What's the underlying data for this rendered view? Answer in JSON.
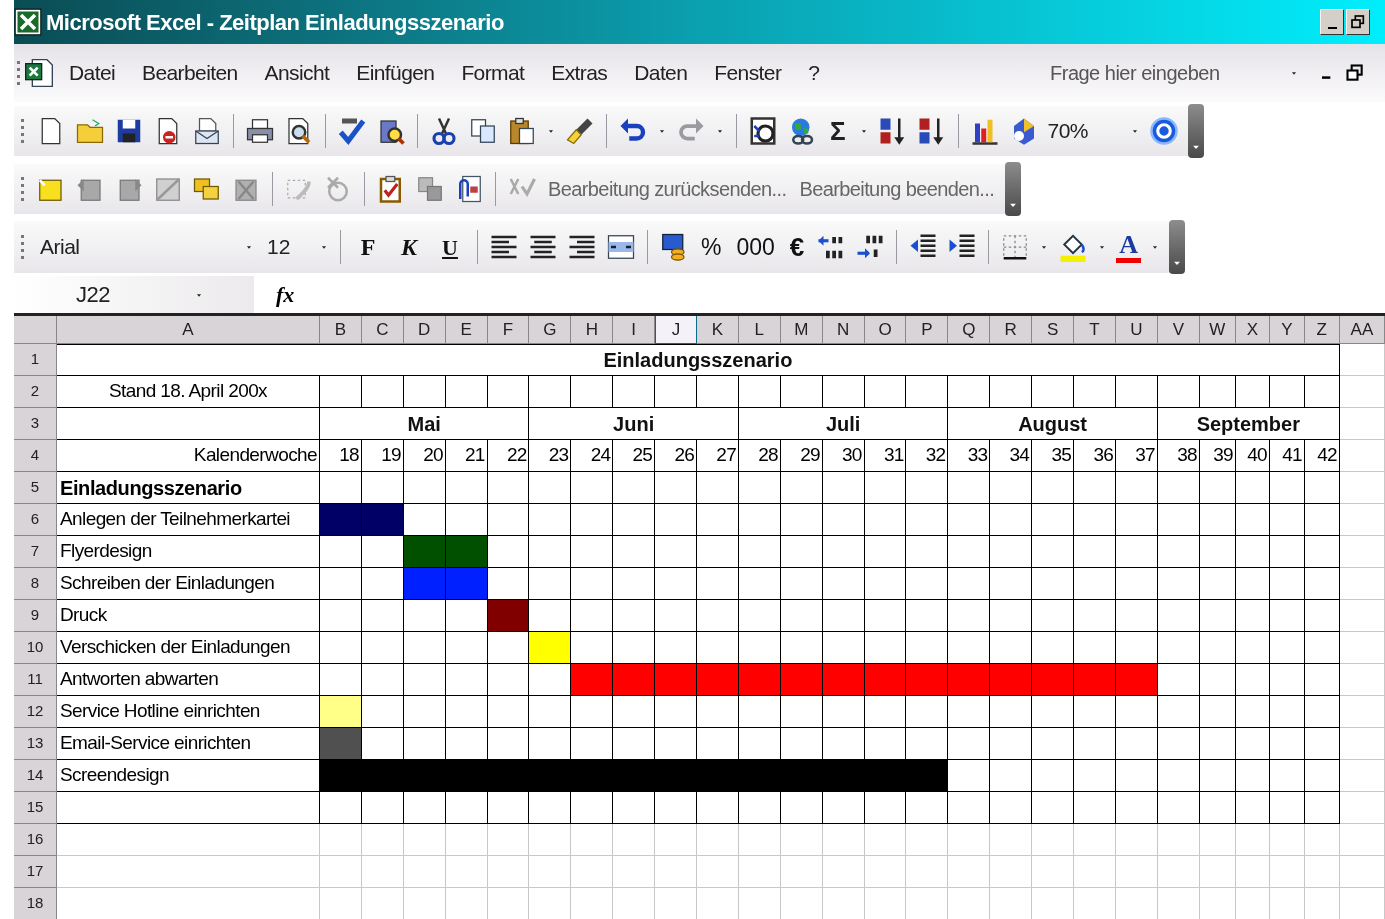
{
  "window": {
    "title": "Microsoft Excel - Zeitplan Einladungsszenario"
  },
  "menu": {
    "items": [
      "Datei",
      "Bearbeiten",
      "Ansicht",
      "Einfügen",
      "Format",
      "Extras",
      "Daten",
      "Fenster",
      "?"
    ],
    "question_placeholder": "Frage hier eingeben"
  },
  "standard_toolbar": {
    "sum": "Σ",
    "zoom": "70%"
  },
  "review_toolbar": {
    "buttons": [
      "Bearbeitung zurücksenden...",
      "Bearbeitung beenden..."
    ]
  },
  "format_toolbar": {
    "font": "Arial",
    "size": "12",
    "style_buttons": [
      "F",
      "K",
      "U"
    ],
    "number_buttons": [
      "%",
      "000",
      "€"
    ],
    "font_color": "A"
  },
  "formula_bar": {
    "name_box": "J22",
    "function_label": "fx"
  },
  "sheet": {
    "columns": [
      {
        "label": "A",
        "selected": false
      },
      {
        "label": "B",
        "selected": false
      },
      {
        "label": "C",
        "selected": false
      },
      {
        "label": "D",
        "selected": false
      },
      {
        "label": "E",
        "selected": false
      },
      {
        "label": "F",
        "selected": false
      },
      {
        "label": "G",
        "selected": false
      },
      {
        "label": "H",
        "selected": false
      },
      {
        "label": "I",
        "selected": false
      },
      {
        "label": "J",
        "selected": true
      },
      {
        "label": "K",
        "selected": false
      },
      {
        "label": "L",
        "selected": false
      },
      {
        "label": "M",
        "selected": false
      },
      {
        "label": "N",
        "selected": false
      },
      {
        "label": "O",
        "selected": false
      },
      {
        "label": "P",
        "selected": false
      },
      {
        "label": "Q",
        "selected": false
      },
      {
        "label": "R",
        "selected": false
      },
      {
        "label": "S",
        "selected": false
      },
      {
        "label": "T",
        "selected": false
      },
      {
        "label": "U",
        "selected": false
      },
      {
        "label": "V",
        "selected": false
      },
      {
        "label": "W",
        "selected": false
      },
      {
        "label": "X",
        "selected": false
      },
      {
        "label": "Y",
        "selected": false
      },
      {
        "label": "Z",
        "selected": false
      },
      {
        "label": "AA",
        "selected": false
      }
    ],
    "row_numbers": [
      "1",
      "2",
      "3",
      "4",
      "5",
      "6",
      "7",
      "8",
      "9",
      "10",
      "11",
      "12",
      "13",
      "14",
      "15",
      "16",
      "17",
      "18"
    ],
    "title": "Einladungsszenario",
    "stand": "Stand 18. April 200x",
    "months": [
      "Mai",
      "Juni",
      "Juli",
      "August",
      "September"
    ],
    "week_label": "Kalenderwoche",
    "weeks": [
      "18",
      "19",
      "20",
      "21",
      "22",
      "23",
      "24",
      "25",
      "26",
      "27",
      "28",
      "29",
      "30",
      "31",
      "32",
      "33",
      "34",
      "35",
      "36",
      "37",
      "38",
      "39",
      "40",
      "41",
      "42"
    ],
    "section": "Einladungsszenario",
    "tasks": [
      {
        "name": "Anlegen der Teilnehmerkartei",
        "cells": [
          {
            "filled": true,
            "color": "#000066"
          },
          {
            "filled": true,
            "color": "#000066"
          },
          {
            "filled": false
          },
          {
            "filled": false
          },
          {
            "filled": false
          },
          {
            "filled": false
          },
          {
            "filled": false
          },
          {
            "filled": false
          },
          {
            "filled": false
          },
          {
            "filled": false
          },
          {
            "filled": false
          },
          {
            "filled": false
          },
          {
            "filled": false
          },
          {
            "filled": false
          },
          {
            "filled": false
          },
          {
            "filled": false
          },
          {
            "filled": false
          },
          {
            "filled": false
          },
          {
            "filled": false
          },
          {
            "filled": false
          },
          {
            "filled": false
          },
          {
            "filled": false
          },
          {
            "filled": false
          },
          {
            "filled": false
          },
          {
            "filled": false
          }
        ]
      },
      {
        "name": "Flyerdesign",
        "cells": [
          {
            "filled": false
          },
          {
            "filled": false
          },
          {
            "filled": true,
            "color": "#005000"
          },
          {
            "filled": true,
            "color": "#005000"
          },
          {
            "filled": false
          },
          {
            "filled": false
          },
          {
            "filled": false
          },
          {
            "filled": false
          },
          {
            "filled": false
          },
          {
            "filled": false
          },
          {
            "filled": false
          },
          {
            "filled": false
          },
          {
            "filled": false
          },
          {
            "filled": false
          },
          {
            "filled": false
          },
          {
            "filled": false
          },
          {
            "filled": false
          },
          {
            "filled": false
          },
          {
            "filled": false
          },
          {
            "filled": false
          },
          {
            "filled": false
          },
          {
            "filled": false
          },
          {
            "filled": false
          },
          {
            "filled": false
          },
          {
            "filled": false
          }
        ]
      },
      {
        "name": "Schreiben der Einladungen",
        "cells": [
          {
            "filled": false
          },
          {
            "filled": false
          },
          {
            "filled": true,
            "color": "#0020ff"
          },
          {
            "filled": true,
            "color": "#0020ff"
          },
          {
            "filled": false
          },
          {
            "filled": false
          },
          {
            "filled": false
          },
          {
            "filled": false
          },
          {
            "filled": false
          },
          {
            "filled": false
          },
          {
            "filled": false
          },
          {
            "filled": false
          },
          {
            "filled": false
          },
          {
            "filled": false
          },
          {
            "filled": false
          },
          {
            "filled": false
          },
          {
            "filled": false
          },
          {
            "filled": false
          },
          {
            "filled": false
          },
          {
            "filled": false
          },
          {
            "filled": false
          },
          {
            "filled": false
          },
          {
            "filled": false
          },
          {
            "filled": false
          },
          {
            "filled": false
          }
        ]
      },
      {
        "name": "Druck",
        "cells": [
          {
            "filled": false
          },
          {
            "filled": false
          },
          {
            "filled": false
          },
          {
            "filled": false
          },
          {
            "filled": true,
            "color": "#800000"
          },
          {
            "filled": false
          },
          {
            "filled": false
          },
          {
            "filled": false
          },
          {
            "filled": false
          },
          {
            "filled": false
          },
          {
            "filled": false
          },
          {
            "filled": false
          },
          {
            "filled": false
          },
          {
            "filled": false
          },
          {
            "filled": false
          },
          {
            "filled": false
          },
          {
            "filled": false
          },
          {
            "filled": false
          },
          {
            "filled": false
          },
          {
            "filled": false
          },
          {
            "filled": false
          },
          {
            "filled": false
          },
          {
            "filled": false
          },
          {
            "filled": false
          },
          {
            "filled": false
          }
        ]
      },
      {
        "name": "Verschicken der Einladungen",
        "cells": [
          {
            "filled": false
          },
          {
            "filled": false
          },
          {
            "filled": false
          },
          {
            "filled": false
          },
          {
            "filled": false
          },
          {
            "filled": true,
            "color": "#ffff00"
          },
          {
            "filled": false
          },
          {
            "filled": false
          },
          {
            "filled": false
          },
          {
            "filled": false
          },
          {
            "filled": false
          },
          {
            "filled": false
          },
          {
            "filled": false
          },
          {
            "filled": false
          },
          {
            "filled": false
          },
          {
            "filled": false
          },
          {
            "filled": false
          },
          {
            "filled": false
          },
          {
            "filled": false
          },
          {
            "filled": false
          },
          {
            "filled": false
          },
          {
            "filled": false
          },
          {
            "filled": false
          },
          {
            "filled": false
          },
          {
            "filled": false
          }
        ]
      },
      {
        "name": "Antworten abwarten",
        "cells": [
          {
            "filled": false
          },
          {
            "filled": false
          },
          {
            "filled": false
          },
          {
            "filled": false
          },
          {
            "filled": false
          },
          {
            "filled": false
          },
          {
            "filled": true,
            "color": "#ff0000"
          },
          {
            "filled": true,
            "color": "#ff0000"
          },
          {
            "filled": true,
            "color": "#ff0000"
          },
          {
            "filled": true,
            "color": "#ff0000"
          },
          {
            "filled": true,
            "color": "#ff0000"
          },
          {
            "filled": true,
            "color": "#ff0000"
          },
          {
            "filled": true,
            "color": "#ff0000"
          },
          {
            "filled": true,
            "color": "#ff0000"
          },
          {
            "filled": true,
            "color": "#ff0000"
          },
          {
            "filled": true,
            "color": "#ff0000"
          },
          {
            "filled": true,
            "color": "#ff0000"
          },
          {
            "filled": true,
            "color": "#ff0000"
          },
          {
            "filled": true,
            "color": "#ff0000"
          },
          {
            "filled": true,
            "color": "#ff0000"
          },
          {
            "filled": false
          },
          {
            "filled": false
          },
          {
            "filled": false
          },
          {
            "filled": false
          },
          {
            "filled": false
          }
        ]
      },
      {
        "name": "Service Hotline einrichten",
        "cells": [
          {
            "filled": true,
            "color": "#ffff88"
          },
          {
            "filled": false
          },
          {
            "filled": false
          },
          {
            "filled": false
          },
          {
            "filled": false
          },
          {
            "filled": false
          },
          {
            "filled": false
          },
          {
            "filled": false
          },
          {
            "filled": false
          },
          {
            "filled": false
          },
          {
            "filled": false
          },
          {
            "filled": false
          },
          {
            "filled": false
          },
          {
            "filled": false
          },
          {
            "filled": false
          },
          {
            "filled": false
          },
          {
            "filled": false
          },
          {
            "filled": false
          },
          {
            "filled": false
          },
          {
            "filled": false
          },
          {
            "filled": false
          },
          {
            "filled": false
          },
          {
            "filled": false
          },
          {
            "filled": false
          },
          {
            "filled": false
          }
        ]
      },
      {
        "name": "Email-Service einrichten",
        "cells": [
          {
            "filled": true,
            "color": "#505050"
          },
          {
            "filled": false
          },
          {
            "filled": false
          },
          {
            "filled": false
          },
          {
            "filled": false
          },
          {
            "filled": false
          },
          {
            "filled": false
          },
          {
            "filled": false
          },
          {
            "filled": false
          },
          {
            "filled": false
          },
          {
            "filled": false
          },
          {
            "filled": false
          },
          {
            "filled": false
          },
          {
            "filled": false
          },
          {
            "filled": false
          },
          {
            "filled": false
          },
          {
            "filled": false
          },
          {
            "filled": false
          },
          {
            "filled": false
          },
          {
            "filled": false
          },
          {
            "filled": false
          },
          {
            "filled": false
          },
          {
            "filled": false
          },
          {
            "filled": false
          },
          {
            "filled": false
          }
        ]
      },
      {
        "name": "Screendesign",
        "cells": [
          {
            "filled": true,
            "color": "#000000"
          },
          {
            "filled": true,
            "color": "#000000"
          },
          {
            "filled": true,
            "color": "#000000"
          },
          {
            "filled": true,
            "color": "#000000"
          },
          {
            "filled": true,
            "color": "#000000"
          },
          {
            "filled": true,
            "color": "#000000"
          },
          {
            "filled": true,
            "color": "#000000"
          },
          {
            "filled": true,
            "color": "#000000"
          },
          {
            "filled": true,
            "color": "#000000"
          },
          {
            "filled": true,
            "color": "#000000"
          },
          {
            "filled": true,
            "color": "#000000"
          },
          {
            "filled": true,
            "color": "#000000"
          },
          {
            "filled": true,
            "color": "#000000"
          },
          {
            "filled": true,
            "color": "#000000"
          },
          {
            "filled": true,
            "color": "#000000"
          },
          {
            "filled": false
          },
          {
            "filled": false
          },
          {
            "filled": false
          },
          {
            "filled": false
          },
          {
            "filled": false
          },
          {
            "filled": false
          },
          {
            "filled": false
          },
          {
            "filled": false
          },
          {
            "filled": false
          },
          {
            "filled": false
          }
        ]
      }
    ]
  }
}
